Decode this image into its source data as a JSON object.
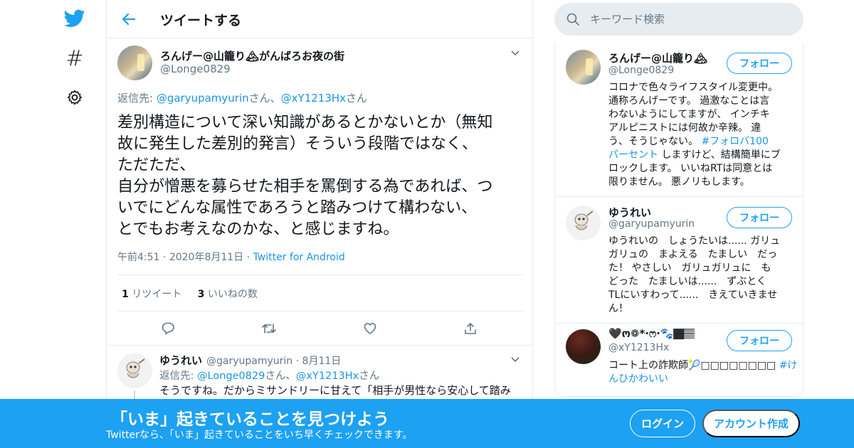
{
  "colors": {
    "accent": "#1da1f2",
    "link": "#1b95e0",
    "text": "#14171a",
    "muted": "#657786",
    "border": "#e6ecf0"
  },
  "nav": {
    "icons": [
      "twitter-bird-icon",
      "hashtag-icon",
      "gear-icon"
    ]
  },
  "header": {
    "title": "ツイートする"
  },
  "tweet": {
    "author_name": "ろんげー@山籠り🏔がんばろお夜の街",
    "author_handle": "@Longe0829",
    "reply_prefix": "返信先: ",
    "reply_user1": "@garyupamyurin",
    "reply_sep": "さん、",
    "reply_user2": "@xY1213Hx",
    "reply_suffix": "さん",
    "body_lines": [
      "差別構造について深い知識があるとかないとか（無知",
      "故に発生した差別的発言）そういう段階ではなく、",
      "ただただ、",
      "自分が憎悪を募らせた相手を罵倒する為であれば、つ",
      "いでにどんな属性であろうと踏みつけて構わない、",
      "とでもお考えなのかな、と感じますね。"
    ],
    "time": "午前4:51",
    "date": "2020年8月11日",
    "source": "Twitter for Android",
    "retweet_count": "1",
    "retweet_label": " リツイート",
    "like_count": "3",
    "like_label": " いいねの数"
  },
  "reply": {
    "author_name": "ゆうれい",
    "author_handle": "@garyupamyurin",
    "date": "8月11日",
    "reply_prefix": "返信先: ",
    "reply_user1": "@Longe0829",
    "reply_sep": "さん、",
    "reply_user2": "@xY1213Hx",
    "reply_suffix": "さん",
    "text": "そうですね。だからミサンドリーに甘えて「相手が男性なら安心して踏み"
  },
  "search": {
    "placeholder": "キーワード検索"
  },
  "users": [
    {
      "name": "ろんげー@山籠り🏔",
      "handle": "@Longe0829",
      "follow_label": "フォロー",
      "bio_lines": [
        "コロナで色々ライフスタイル変更中。",
        "通称ろんげーです。 過激なことは言",
        "わないようにしてますが、 インチキ",
        "アルピニストには何故か辛辣。 違",
        "う、そうじゃない。 ",
        "パーセント",
        " しますけど、結構簡単にブ",
        "ロックします。 いいねRTは同意とは",
        "限りません。 悪ノリもします。"
      ],
      "hashtag": "#フォロバ100"
    },
    {
      "name": "ゆうれい",
      "handle": "@garyupamyurin",
      "follow_label": "フォロー",
      "bio_lines": [
        "ゆうれいの　しょうたいは...... ガリュ",
        "ガリュの　まよえる　たましい　だっ",
        "た！ やさしい　ガリュガリュに　も",
        "どった　たましいは......　ずぶとく",
        "TLにいすわって......　きえていきませ",
        "ん！"
      ]
    },
    {
      "name": "🖤ო❁*·ෆ·🐾🏾🏽",
      "handle": "@xY1213Hx",
      "follow_label": "フォロー",
      "bio_line1": "コート上の詐欺師🎾□□□□□□□□ ",
      "bio_hashtag1": "#け",
      "bio_hashtag2": "んひかわいい"
    }
  ],
  "banner": {
    "title": "「いま」起きていることを見つけよう",
    "subtitle": "Twitterなら、「いま」起きていることをいち早くチェックできます。",
    "login_label": "ログイン",
    "signup_label": "アカウント作成"
  }
}
